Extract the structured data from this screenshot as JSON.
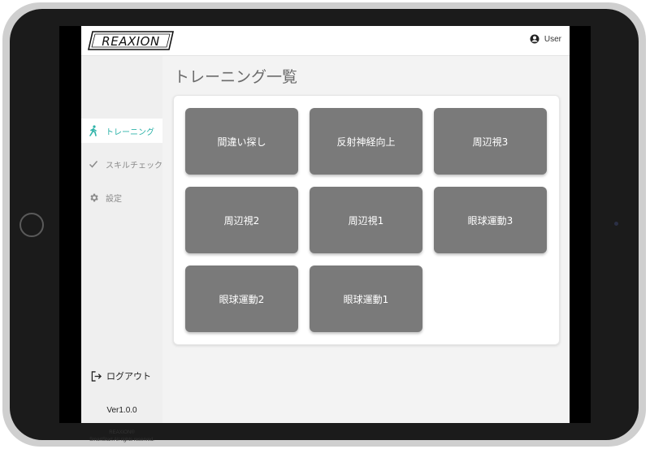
{
  "header": {
    "logo_text": "REAXION",
    "user_label": "User"
  },
  "sidebar": {
    "items": [
      {
        "label": "トレーニング",
        "icon": "walk-icon",
        "active": true
      },
      {
        "label": "スキルチェック",
        "icon": "check-icon",
        "active": false
      },
      {
        "label": "設定",
        "icon": "gear-icon",
        "active": false
      }
    ],
    "logout_label": "ログアウト",
    "version": "Ver1.0.0",
    "copyright_line1": "REAXION®",
    "copyright_line2": "SmartStart All rights reserved."
  },
  "main": {
    "title": "トレーニング一覧",
    "tiles": [
      "間違い探し",
      "反射神経向上",
      "周辺視3",
      "周辺視2",
      "周辺視1",
      "眼球運動3",
      "眼球運動2",
      "眼球運動1"
    ]
  },
  "colors": {
    "accent": "#2fb3a9",
    "tile": "#7a7a7a",
    "sidebar_bg": "#efefef",
    "content_bg": "#f3f3f3"
  }
}
